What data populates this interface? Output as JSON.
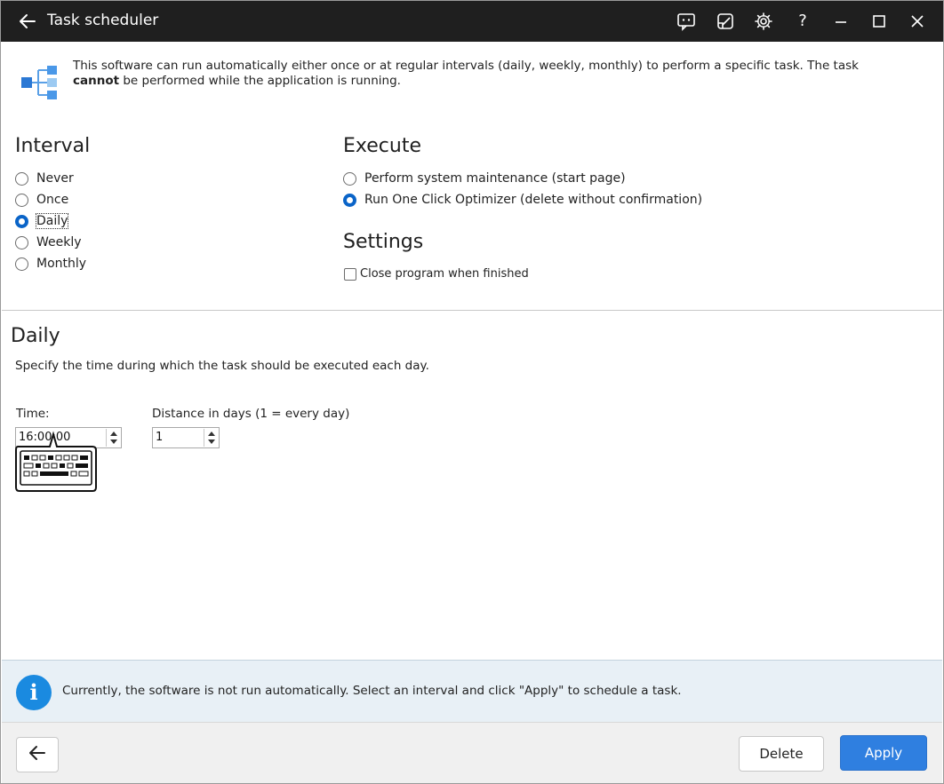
{
  "titlebar": {
    "title": "Task scheduler",
    "icons": [
      "back-arrow-icon",
      "feedback-icon",
      "notes-icon",
      "gear-icon",
      "help-icon",
      "minimize-icon",
      "maximize-icon",
      "close-icon"
    ],
    "help_label": "?"
  },
  "intro": {
    "text_part1": "This software can run automatically either once or at regular intervals (daily, weekly, monthly) to perform a specific task. The task ",
    "text_bold": "cannot",
    "text_part2": " be performed while the application is running."
  },
  "interval": {
    "title": "Interval",
    "options": [
      {
        "label": "Never",
        "selected": false
      },
      {
        "label": "Once",
        "selected": false
      },
      {
        "label": "Daily",
        "selected": true
      },
      {
        "label": "Weekly",
        "selected": false
      },
      {
        "label": "Monthly",
        "selected": false
      }
    ]
  },
  "execute": {
    "title": "Execute",
    "options": [
      {
        "label": "Perform system maintenance (start page)",
        "selected": false
      },
      {
        "label": "Run One Click Optimizer (delete without confirmation)",
        "selected": true
      }
    ]
  },
  "settings": {
    "title": "Settings",
    "close_when_finished": {
      "label": "Close program when finished",
      "checked": false
    }
  },
  "daily": {
    "title": "Daily",
    "description": "Specify the time during which the task should be executed each day.",
    "time_label": "Time:",
    "time_value": "16:00:00",
    "distance_label": "Distance in days (1 = every day)",
    "distance_value": "1"
  },
  "infobar": {
    "icon": "info-icon",
    "icon_glyph": "i",
    "text": "Currently, the software is not run automatically. Select an interval and click \"Apply\" to schedule a task."
  },
  "footer": {
    "back_icon": "back-arrow-icon",
    "delete_label": "Delete",
    "apply_label": "Apply"
  },
  "colors": {
    "titlebar_bg": "#1f1f1f",
    "accent": "#0a64c8",
    "apply_button": "#2f7fe0",
    "infobar_bg": "#e8f0f6",
    "info_icon": "#1a8ae0"
  }
}
